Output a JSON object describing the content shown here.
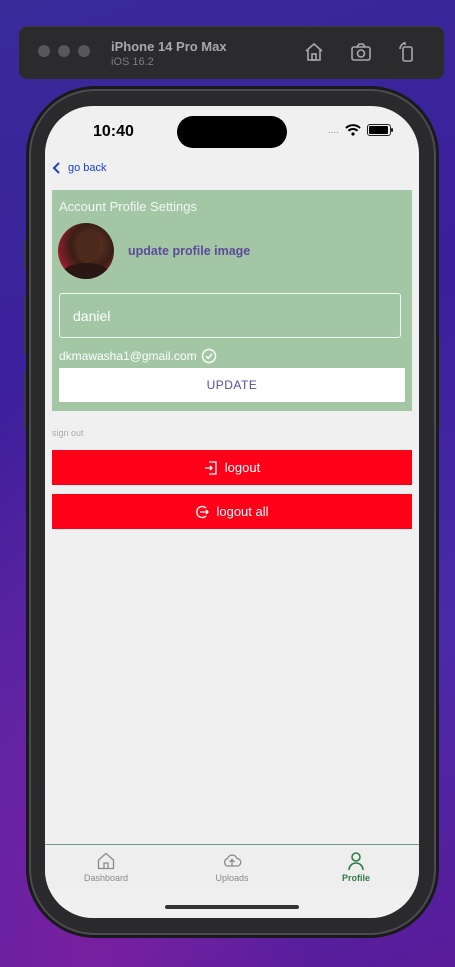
{
  "simulator": {
    "device_name": "iPhone 14 Pro Max",
    "os_version": "iOS 16.2",
    "toolbar_icons": [
      "home-icon",
      "screenshot-icon",
      "rotate-icon"
    ]
  },
  "status_bar": {
    "time": "10:40",
    "signal": "....",
    "icons": [
      "wifi-icon",
      "battery-icon"
    ]
  },
  "nav": {
    "back_label": "go back"
  },
  "profile_card": {
    "title": "Account Profile Settings",
    "update_image_label": "update profile image",
    "name_value": "daniel",
    "email": "dkmawasha1@gmail.com",
    "update_button_label": "UPDATE",
    "background_color": "#a3c6a5"
  },
  "sign_out": {
    "section_label": "sign out",
    "logout_label": "logout",
    "logout_all_label": "logout all",
    "button_color": "#ff0018"
  },
  "tabbar": {
    "tabs": [
      {
        "label": "Dashboard",
        "icon": "home-icon",
        "active": false
      },
      {
        "label": "Uploads",
        "icon": "cloud-upload-icon",
        "active": false
      },
      {
        "label": "Profile",
        "icon": "person-icon",
        "active": true
      }
    ],
    "active_color": "#2f7a4a"
  }
}
